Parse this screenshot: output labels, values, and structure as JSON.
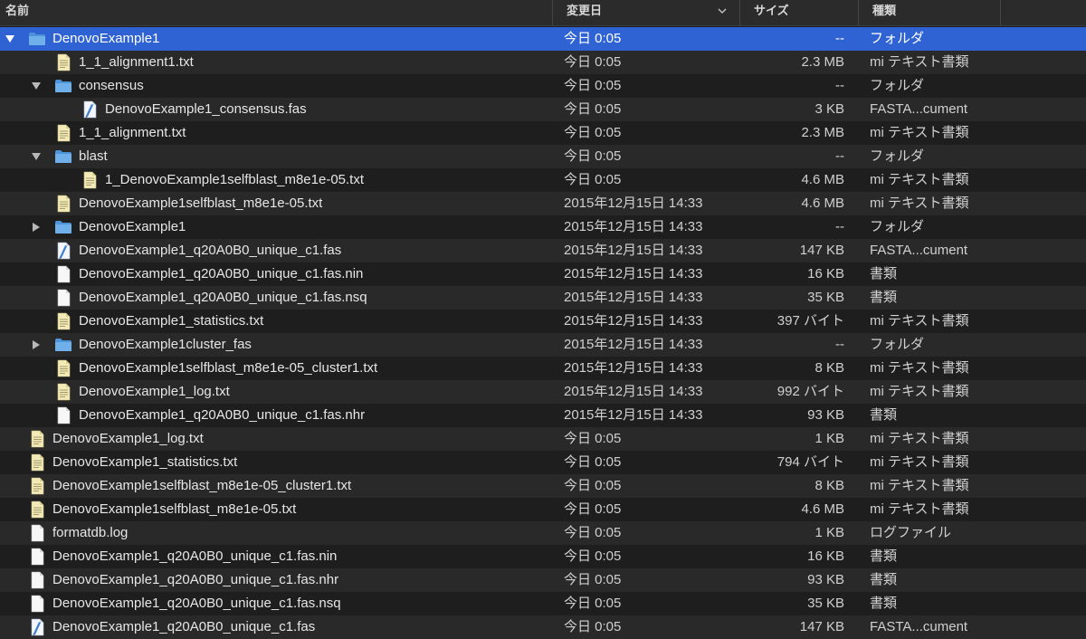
{
  "columns": {
    "name": "名前",
    "date": "変更日",
    "size": "サイズ",
    "kind": "種類"
  },
  "colors": {
    "selection": "#2f63d3",
    "folder": "#6fb0ea",
    "text_doc": "#f3eab8",
    "background": "#1e1e1e"
  },
  "rows": [
    {
      "name": "DenovoExample1",
      "date": "今日 0:05",
      "size": "--",
      "kind": "フォルダ",
      "icon": "folder-icon",
      "level": 0,
      "disclosure": "expanded",
      "selected": true
    },
    {
      "name": "1_1_alignment1.txt",
      "date": "今日 0:05",
      "size": "2.3 MB",
      "kind": "mi テキスト書類",
      "icon": "text-document-icon",
      "level": 1,
      "disclosure": "none"
    },
    {
      "name": "consensus",
      "date": "今日 0:05",
      "size": "--",
      "kind": "フォルダ",
      "icon": "folder-icon",
      "level": 1,
      "disclosure": "expanded"
    },
    {
      "name": "DenovoExample1_consensus.fas",
      "date": "今日 0:05",
      "size": "3 KB",
      "kind": "FASTA...cument",
      "icon": "fasta-document-icon",
      "level": 2,
      "disclosure": "none"
    },
    {
      "name": "1_1_alignment.txt",
      "date": "今日 0:05",
      "size": "2.3 MB",
      "kind": "mi テキスト書類",
      "icon": "text-document-icon",
      "level": 1,
      "disclosure": "none"
    },
    {
      "name": "blast",
      "date": "今日 0:05",
      "size": "--",
      "kind": "フォルダ",
      "icon": "folder-icon",
      "level": 1,
      "disclosure": "expanded"
    },
    {
      "name": "1_DenovoExample1selfblast_m8e1e-05.txt",
      "date": "今日 0:05",
      "size": "4.6 MB",
      "kind": "mi テキスト書類",
      "icon": "text-document-icon",
      "level": 2,
      "disclosure": "none"
    },
    {
      "name": "DenovoExample1selfblast_m8e1e-05.txt",
      "date": "2015年12月15日 14:33",
      "size": "4.6 MB",
      "kind": "mi テキスト書類",
      "icon": "text-document-icon",
      "level": 1,
      "disclosure": "none"
    },
    {
      "name": "DenovoExample1",
      "date": "2015年12月15日 14:33",
      "size": "--",
      "kind": "フォルダ",
      "icon": "folder-icon",
      "level": 1,
      "disclosure": "collapsed"
    },
    {
      "name": "DenovoExample1_q20A0B0_unique_c1.fas",
      "date": "2015年12月15日 14:33",
      "size": "147 KB",
      "kind": "FASTA...cument",
      "icon": "fasta-document-icon",
      "level": 1,
      "disclosure": "none"
    },
    {
      "name": "DenovoExample1_q20A0B0_unique_c1.fas.nin",
      "date": "2015年12月15日 14:33",
      "size": "16 KB",
      "kind": "書類",
      "icon": "blank-document-icon",
      "level": 1,
      "disclosure": "none"
    },
    {
      "name": "DenovoExample1_q20A0B0_unique_c1.fas.nsq",
      "date": "2015年12月15日 14:33",
      "size": "35 KB",
      "kind": "書類",
      "icon": "blank-document-icon",
      "level": 1,
      "disclosure": "none"
    },
    {
      "name": "DenovoExample1_statistics.txt",
      "date": "2015年12月15日 14:33",
      "size": "397 バイト",
      "kind": "mi テキスト書類",
      "icon": "text-document-icon",
      "level": 1,
      "disclosure": "none"
    },
    {
      "name": "DenovoExample1cluster_fas",
      "date": "2015年12月15日 14:33",
      "size": "--",
      "kind": "フォルダ",
      "icon": "folder-icon",
      "level": 1,
      "disclosure": "collapsed"
    },
    {
      "name": "DenovoExample1selfblast_m8e1e-05_cluster1.txt",
      "date": "2015年12月15日 14:33",
      "size": "8 KB",
      "kind": "mi テキスト書類",
      "icon": "text-document-icon",
      "level": 1,
      "disclosure": "none"
    },
    {
      "name": "DenovoExample1_log.txt",
      "date": "2015年12月15日 14:33",
      "size": "992 バイト",
      "kind": "mi テキスト書類",
      "icon": "text-document-icon",
      "level": 1,
      "disclosure": "none"
    },
    {
      "name": "DenovoExample1_q20A0B0_unique_c1.fas.nhr",
      "date": "2015年12月15日 14:33",
      "size": "93 KB",
      "kind": "書類",
      "icon": "blank-document-icon",
      "level": 1,
      "disclosure": "none"
    },
    {
      "name": "DenovoExample1_log.txt",
      "date": "今日 0:05",
      "size": "1 KB",
      "kind": "mi テキスト書類",
      "icon": "text-document-icon",
      "level": 0,
      "disclosure": "none"
    },
    {
      "name": "DenovoExample1_statistics.txt",
      "date": "今日 0:05",
      "size": "794 バイト",
      "kind": "mi テキスト書類",
      "icon": "text-document-icon",
      "level": 0,
      "disclosure": "none"
    },
    {
      "name": "DenovoExample1selfblast_m8e1e-05_cluster1.txt",
      "date": "今日 0:05",
      "size": "8 KB",
      "kind": "mi テキスト書類",
      "icon": "text-document-icon",
      "level": 0,
      "disclosure": "none"
    },
    {
      "name": "DenovoExample1selfblast_m8e1e-05.txt",
      "date": "今日 0:05",
      "size": "4.6 MB",
      "kind": "mi テキスト書類",
      "icon": "text-document-icon",
      "level": 0,
      "disclosure": "none"
    },
    {
      "name": "formatdb.log",
      "date": "今日 0:05",
      "size": "1 KB",
      "kind": "ログファイル",
      "icon": "blank-document-icon",
      "level": 0,
      "disclosure": "none"
    },
    {
      "name": "DenovoExample1_q20A0B0_unique_c1.fas.nin",
      "date": "今日 0:05",
      "size": "16 KB",
      "kind": "書類",
      "icon": "blank-document-icon",
      "level": 0,
      "disclosure": "none"
    },
    {
      "name": "DenovoExample1_q20A0B0_unique_c1.fas.nhr",
      "date": "今日 0:05",
      "size": "93 KB",
      "kind": "書類",
      "icon": "blank-document-icon",
      "level": 0,
      "disclosure": "none"
    },
    {
      "name": "DenovoExample1_q20A0B0_unique_c1.fas.nsq",
      "date": "今日 0:05",
      "size": "35 KB",
      "kind": "書類",
      "icon": "blank-document-icon",
      "level": 0,
      "disclosure": "none"
    },
    {
      "name": "DenovoExample1_q20A0B0_unique_c1.fas",
      "date": "今日 0:05",
      "size": "147 KB",
      "kind": "FASTA...cument",
      "icon": "fasta-document-icon",
      "level": 0,
      "disclosure": "none"
    }
  ]
}
